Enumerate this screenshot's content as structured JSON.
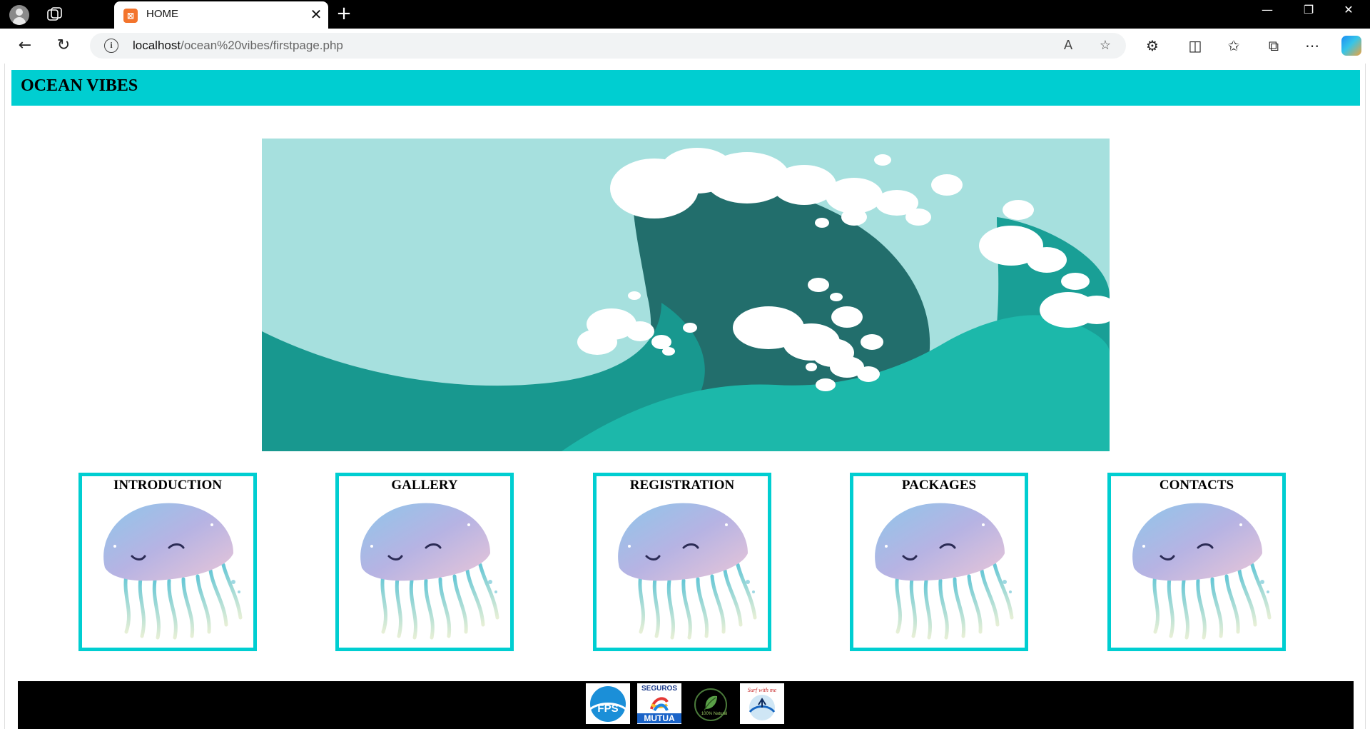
{
  "browser": {
    "tab_title": "HOME",
    "url_host": "localhost",
    "url_path": "/ocean%20vibes/firstpage.php",
    "favicon_letter": "⊠"
  },
  "site": {
    "title": "OCEAN VIBES",
    "accent_color": "#00ced1",
    "hero_image": "ocean-wave-illustration",
    "nav_cards": [
      {
        "label": "INTRODUCTION",
        "image": "jellyfish-illustration"
      },
      {
        "label": "GALLERY",
        "image": "jellyfish-illustration"
      },
      {
        "label": "REGISTRATION",
        "image": "jellyfish-illustration"
      },
      {
        "label": "PACKAGES",
        "image": "jellyfish-illustration"
      },
      {
        "label": "CONTACTS",
        "image": "jellyfish-illustration"
      }
    ],
    "footer_logos": [
      {
        "name": "fps-logo",
        "text": "FPS"
      },
      {
        "name": "seguros-mutua-logo",
        "text_top": "SEGUROS",
        "text_bottom": "MUTUA"
      },
      {
        "name": "natural-leaf-logo",
        "text": "100% Natural"
      },
      {
        "name": "surf-with-me-logo",
        "text": "Surf with me"
      }
    ]
  }
}
